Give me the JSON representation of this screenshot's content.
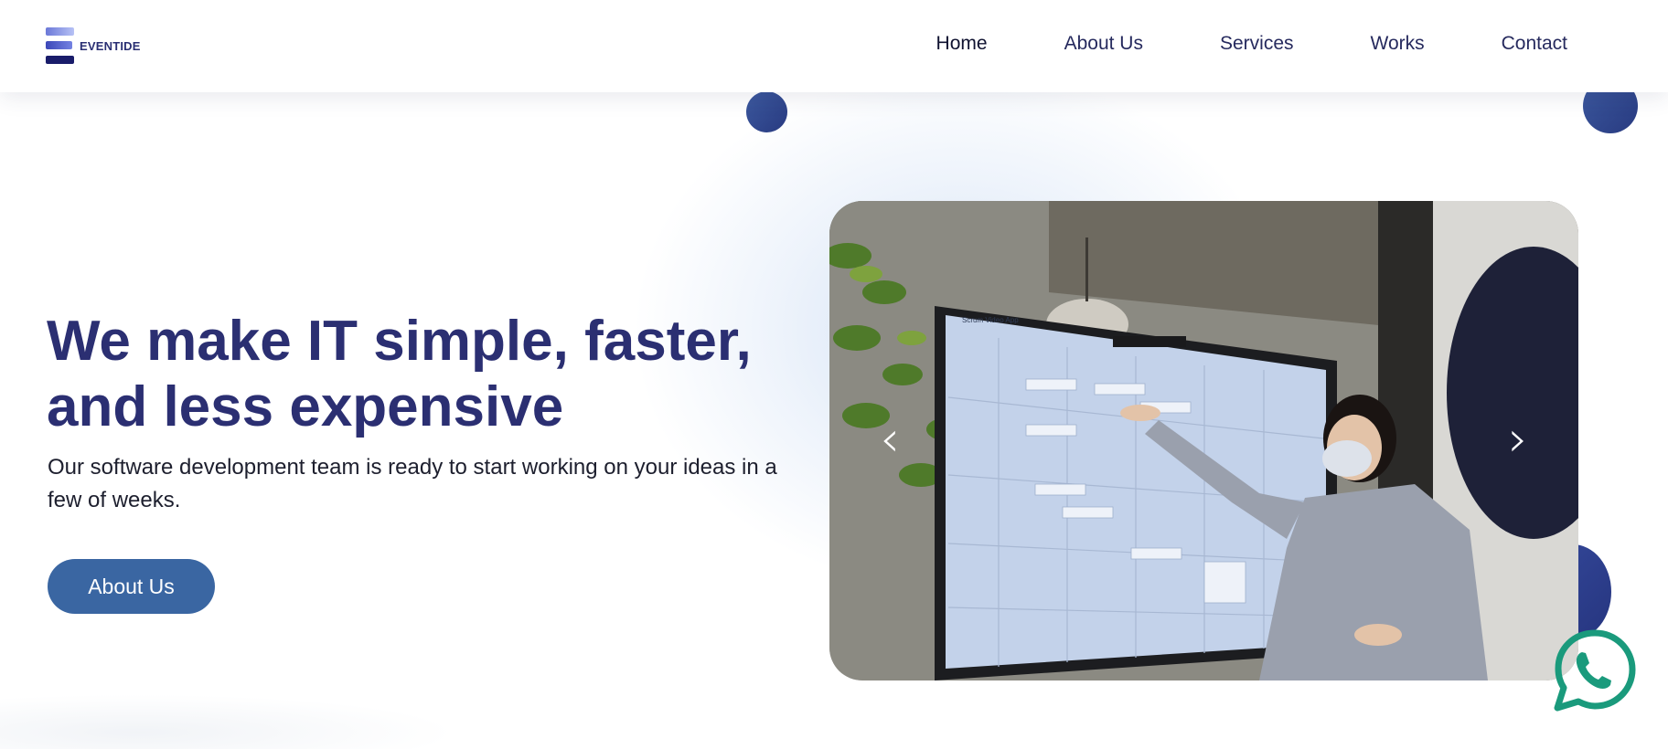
{
  "brand": {
    "name": "EVENTIDE"
  },
  "nav": {
    "items": [
      {
        "label": "Home",
        "active": true
      },
      {
        "label": "About Us",
        "active": false
      },
      {
        "label": "Services",
        "active": false
      },
      {
        "label": "Works",
        "active": false
      },
      {
        "label": "Contact",
        "active": false
      }
    ]
  },
  "hero": {
    "title_line1": "We make IT simple, faster,",
    "title_line2": "and less expensive",
    "subtitle": "Our software development team is ready to start working on your ideas in a few of weeks.",
    "cta_label": "About Us"
  },
  "carousel": {
    "prev_icon": "chevron-left-icon",
    "next_icon": "chevron-right-icon",
    "prev_glyph": "‹",
    "next_glyph": "›",
    "image_title": "Scrum Video App"
  },
  "colors": {
    "primary": "#2b2f72",
    "button": "#3a66a2",
    "accent_dot": "#2f4590",
    "whatsapp": "#1a9a7c"
  }
}
